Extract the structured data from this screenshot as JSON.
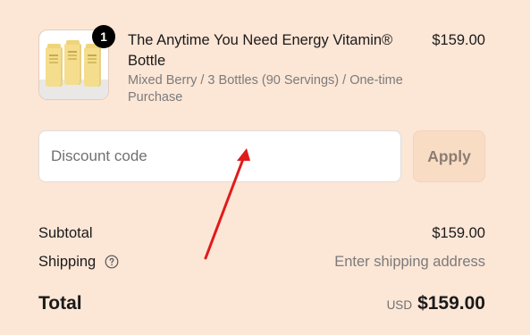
{
  "line_item": {
    "quantity": "1",
    "title": "The Anytime You Need Energy Vitamin® Bottle",
    "variant": "Mixed Berry / 3 Bottles (90 Servings) / One-time Purchase",
    "price": "$159.00"
  },
  "discount": {
    "placeholder": "Discount code",
    "value": "",
    "apply_label": "Apply"
  },
  "summary": {
    "subtotal_label": "Subtotal",
    "subtotal_value": "$159.00",
    "shipping_label": "Shipping",
    "shipping_value": "Enter shipping address",
    "total_label": "Total",
    "currency": "USD",
    "total_value": "$159.00"
  },
  "icons": {
    "help": "question-circle-icon",
    "annotation": "arrow-icon"
  },
  "colors": {
    "background": "#fce6d6",
    "apply_button": "#f9dcc4",
    "annotation_arrow": "#e01b1b"
  }
}
